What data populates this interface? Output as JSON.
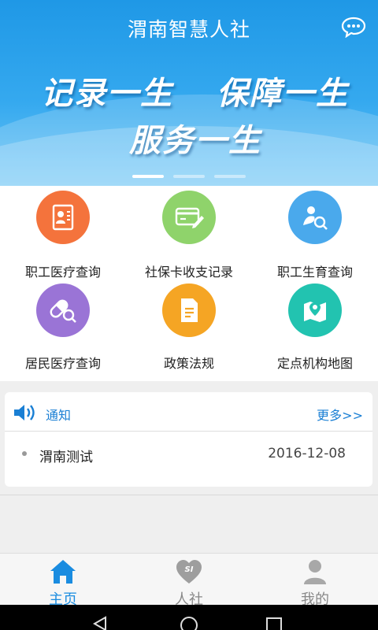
{
  "header": {
    "title": "渭南智慧人社"
  },
  "banner": {
    "slogans": [
      "记录一生",
      "保障一生",
      "服务一生"
    ],
    "active_slide": 1,
    "slide_count": 3
  },
  "grid": {
    "items": [
      {
        "label": "职工医疗查询",
        "color": "#f4733c",
        "icon": "id-card-icon"
      },
      {
        "label": "社保卡收支记录",
        "color": "#8fd36b",
        "icon": "card-edit-icon"
      },
      {
        "label": "职工生育查询",
        "color": "#4aa9ec",
        "icon": "baby-search-icon"
      },
      {
        "label": "居民医疗查询",
        "color": "#9a74d6",
        "icon": "pill-search-icon"
      },
      {
        "label": "政策法规",
        "color": "#f5a524",
        "icon": "document-icon"
      },
      {
        "label": "定点机构地图",
        "color": "#22c3b0",
        "icon": "map-pin-icon"
      }
    ]
  },
  "notice": {
    "title": "通知",
    "more": "更多>>",
    "items": [
      {
        "title": "渭南测试",
        "date": "2016-12-08"
      }
    ]
  },
  "tabbar": {
    "items": [
      {
        "label": "主页",
        "icon": "home-icon",
        "active": true
      },
      {
        "label": "人社",
        "icon": "si-heart-icon",
        "active": false
      },
      {
        "label": "我的",
        "icon": "user-icon",
        "active": false
      }
    ]
  },
  "colors": {
    "accent": "#1a8ce0",
    "banner": "#2aa2ea"
  }
}
